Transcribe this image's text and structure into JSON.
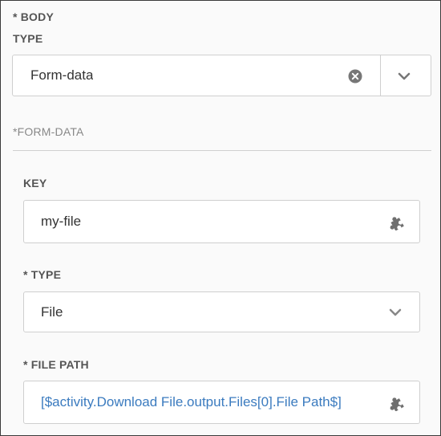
{
  "body": {
    "heading_line1": "* BODY",
    "heading_line2": "TYPE",
    "type_value": "Form-data",
    "clear_icon": "clear-circle-icon",
    "dropdown_icon": "chevron-down-icon"
  },
  "form_data": {
    "heading": "*FORM-DATA",
    "key_label": "KEY",
    "key_value": "my-file",
    "key_icon": "puzzle-icon",
    "type_label": "* TYPE",
    "type_value": "File",
    "type_icon": "chevron-down-icon",
    "file_path_label": "* FILE PATH",
    "file_path_value": "[$activity.Download File.output.Files[0].File Path$]",
    "file_path_icon": "puzzle-icon"
  },
  "colors": {
    "link": "#3b7bbf",
    "label": "#555555",
    "border": "#cfcfcf"
  }
}
